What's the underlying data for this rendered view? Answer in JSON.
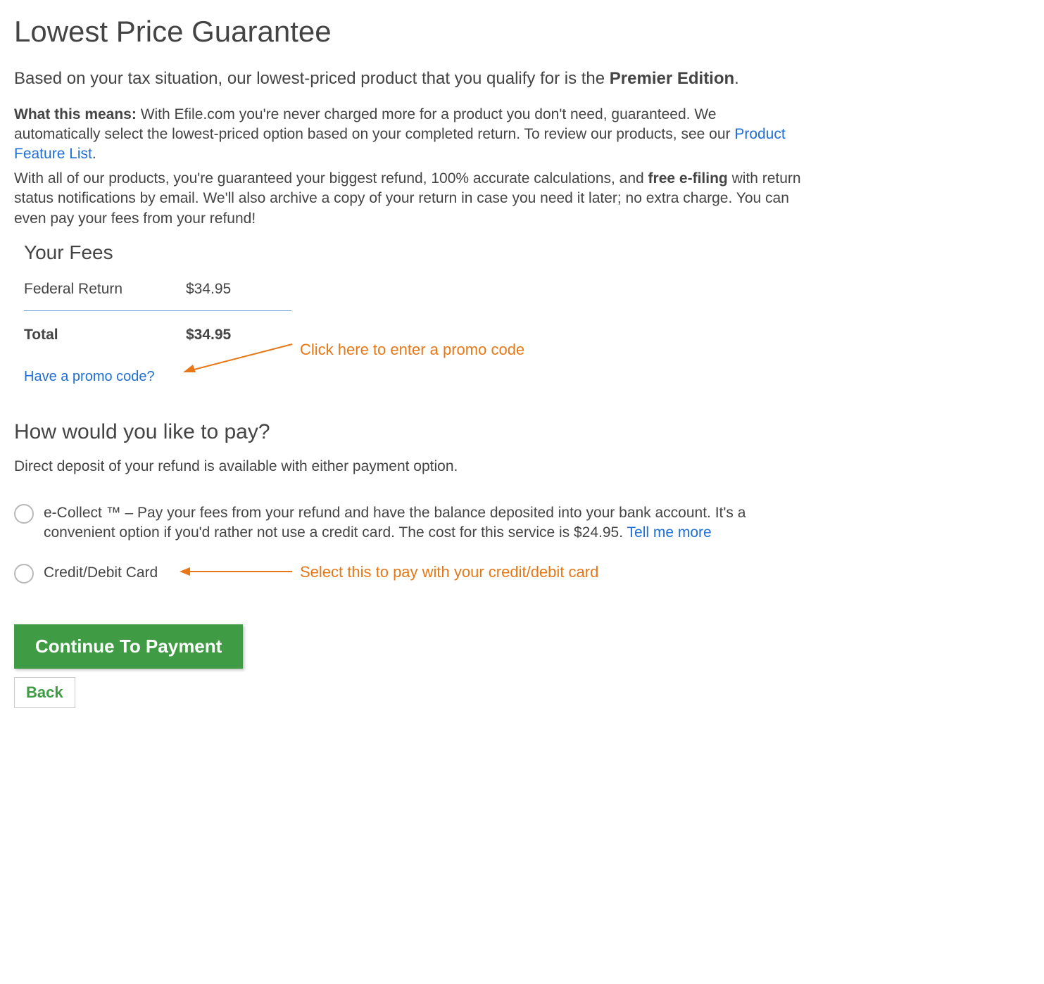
{
  "title": "Lowest Price Guarantee",
  "lead_prefix": "Based on your tax situation, our lowest-priced product that you qualify for is the ",
  "lead_product": "Premier Edition",
  "lead_suffix": ".",
  "what_means_label": "What this means:",
  "what_means_body": " With Efile.com you're never charged more for a product you don't need, guaranteed. We automatically select the lowest-priced option based on your completed return. To review our products, see our ",
  "product_feature_link": "Product Feature List",
  "what_means_tail": ".",
  "guarantee_prefix": "With all of our products, you're guaranteed your biggest refund, 100% accurate calculations, and ",
  "guarantee_bold": "free e-filing",
  "guarantee_suffix": " with return status notifications by email. We'll also archive a copy of your return in case you need it later; no extra charge. You can even pay your fees from your refund!",
  "fees": {
    "title": "Your Fees",
    "row_label": "Federal Return",
    "row_value": "$34.95",
    "total_label": "Total",
    "total_value": "$34.95",
    "promo_link": "Have a promo code?"
  },
  "callouts": {
    "promo": "Click here to enter a promo code",
    "card": "Select this to pay with your credit/debit card"
  },
  "pay": {
    "title": "How would you like to pay?",
    "desc": "Direct deposit of your refund is available with either payment option.",
    "option1_text": "e-Collect ™ – Pay your fees from your refund and have the balance deposited into your bank account. It's a convenient option if you'd rather not use a credit card. The cost for this service is $24.95. ",
    "option1_link": "Tell me more",
    "option2_text": "Credit/Debit Card"
  },
  "buttons": {
    "continue": "Continue To Payment",
    "back": "Back"
  }
}
